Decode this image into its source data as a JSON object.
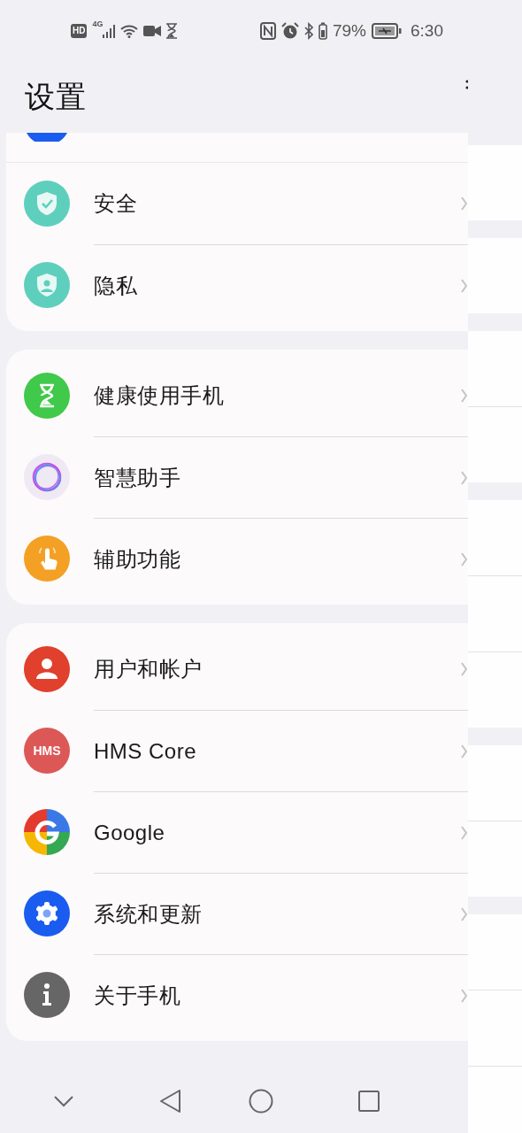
{
  "status_bar": {
    "left_badges": [
      "HD",
      "4G"
    ],
    "battery_percent": "79%",
    "time": "6:30"
  },
  "title": "设置",
  "cards": [
    {
      "items": [
        {
          "kind": "cut_circle"
        },
        {
          "kind": "shield",
          "label": "安全"
        },
        {
          "kind": "privacy",
          "label": "隐私"
        }
      ]
    },
    {
      "items": [
        {
          "kind": "hourglass",
          "label": "健康使用手机"
        },
        {
          "kind": "assistant",
          "label": "智慧助手"
        },
        {
          "kind": "accessibility",
          "label": "辅助功能"
        }
      ]
    },
    {
      "items": [
        {
          "kind": "user",
          "label": "用户和帐户"
        },
        {
          "kind": "hms",
          "label": "HMS Core",
          "icon_text": "HMS"
        },
        {
          "kind": "google",
          "label": "Google"
        },
        {
          "kind": "system",
          "label": "系统和更新"
        },
        {
          "kind": "about",
          "label": "关于手机"
        }
      ]
    }
  ]
}
